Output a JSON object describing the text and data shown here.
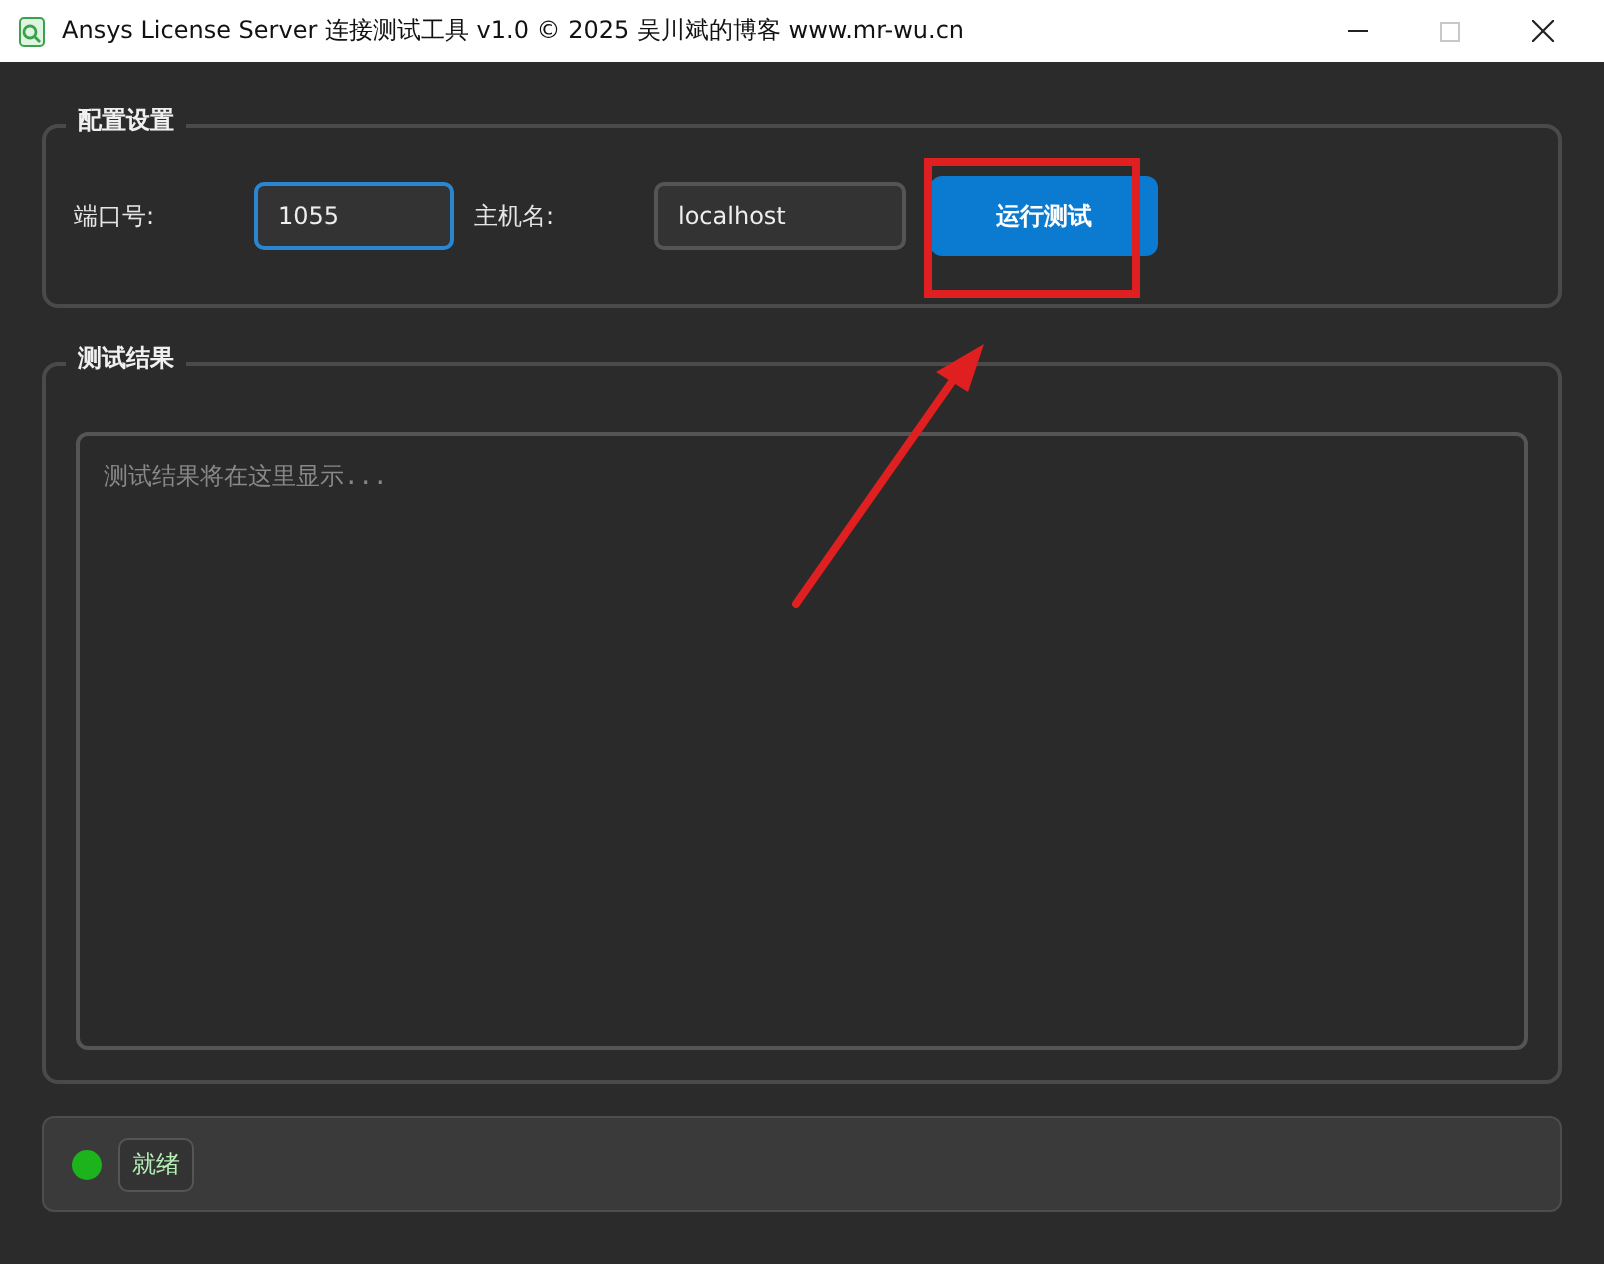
{
  "window": {
    "title": "Ansys License Server 连接测试工具 v1.0 © 2025 吴川斌的博客 www.mr-wu.cn",
    "maximize_disabled": true
  },
  "config": {
    "title": "配置设置",
    "fields": [
      {
        "label": "端口号:",
        "value": "1055",
        "focused": true
      },
      {
        "label": "主机名:",
        "value": "localhost",
        "focused": false
      }
    ],
    "button": "运行测试"
  },
  "results": {
    "title": "测试结果",
    "placeholder": "测试结果将在这里显示..."
  },
  "status_bar": {
    "text": "就绪"
  }
}
